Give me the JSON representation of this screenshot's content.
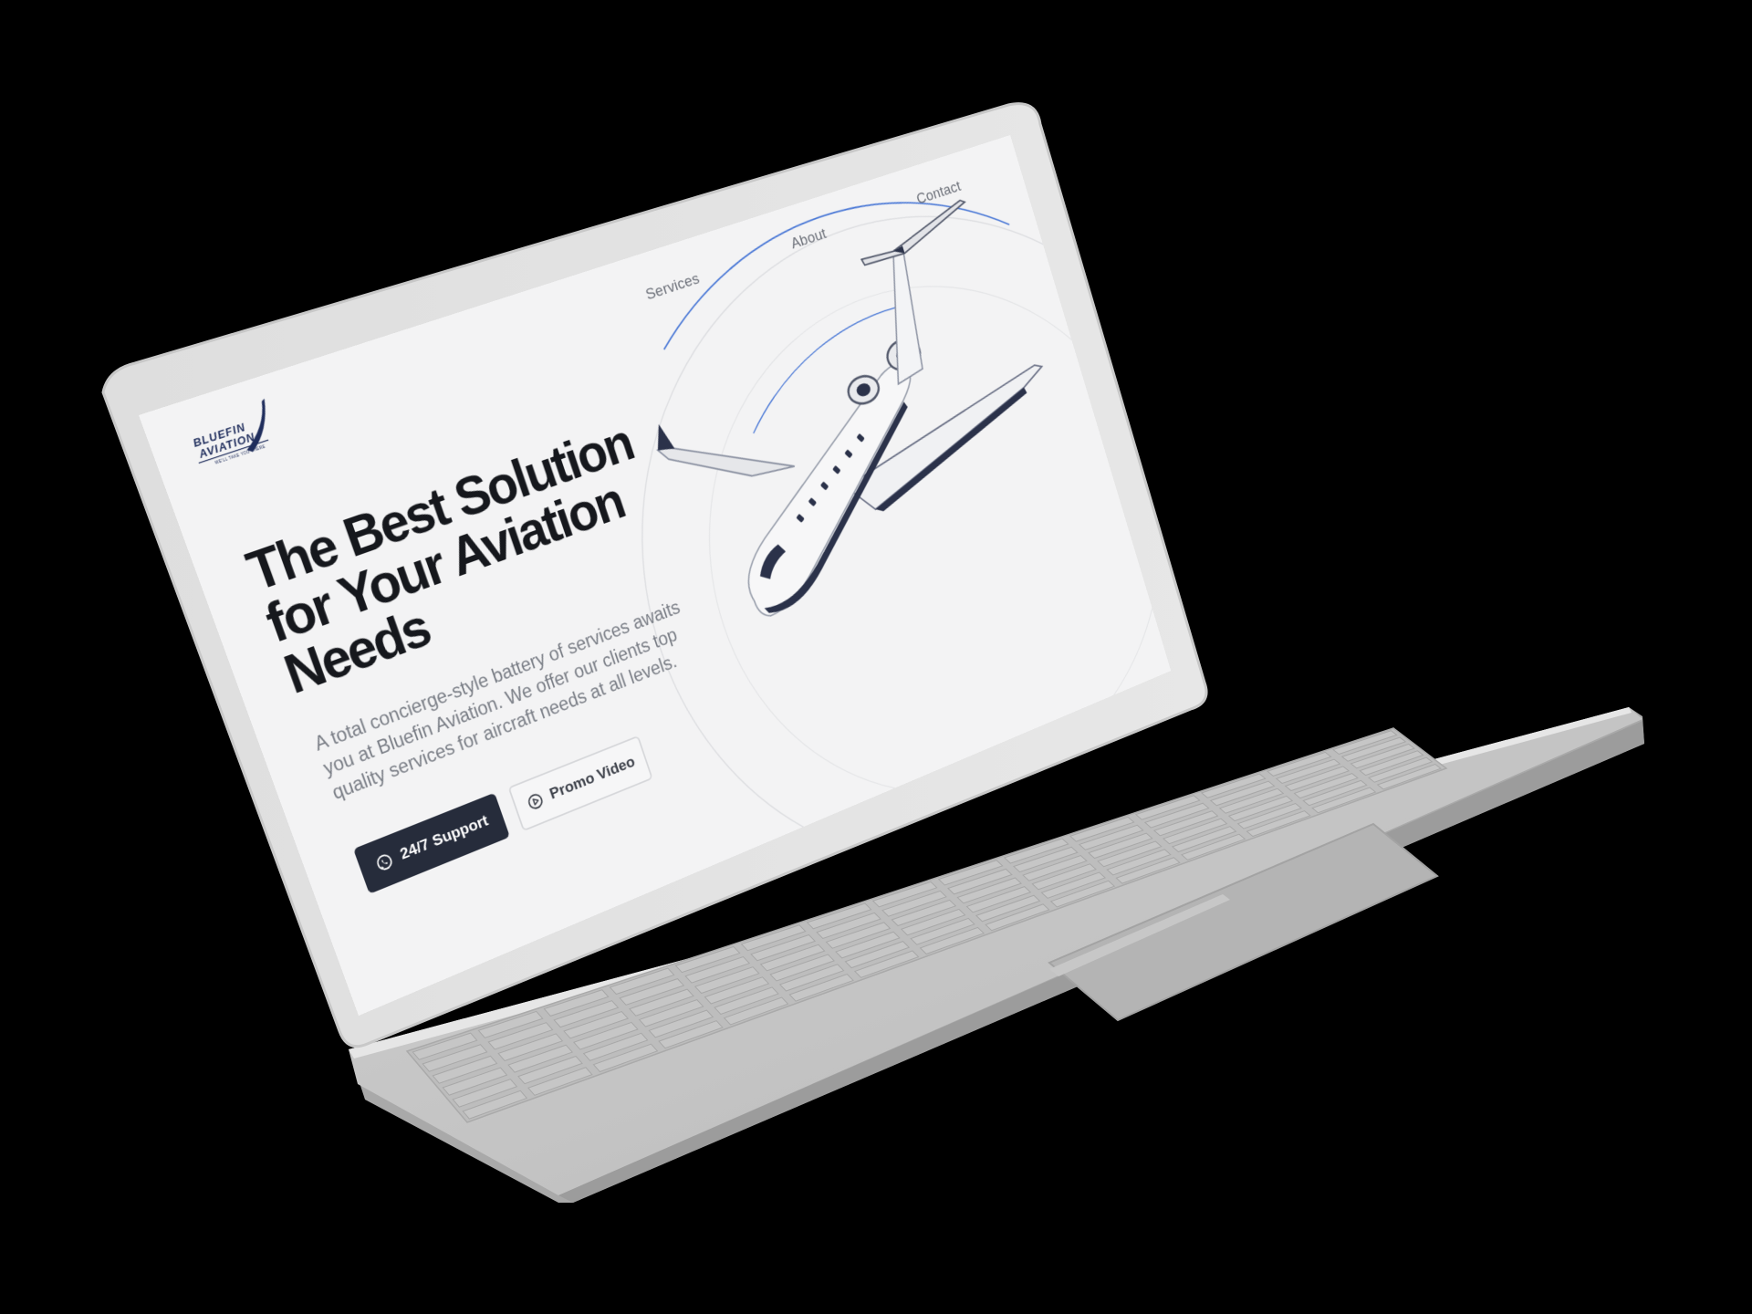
{
  "brand": {
    "name_line1": "BLUEFIN",
    "name_line2": "AVIATION",
    "tagline": "WE'LL TAKE YOU THERE",
    "navy": "#1f2d5c",
    "accent_blue": "#4a78d6"
  },
  "nav": {
    "items": [
      "Services",
      "About",
      "Contact"
    ]
  },
  "hero": {
    "title_lines": [
      "The Best Solution",
      "for Your Aviation",
      "Needs"
    ],
    "subtitle_lines": [
      "A total concierge-style battery of services awaits",
      "you at Bluefin Aviation. We offer our clients top",
      "quality services for aircraft needs at all levels."
    ],
    "primary_button": {
      "label": "24/7 Support",
      "icon": "whatsapp-icon"
    },
    "secondary_button": {
      "label": "Promo Video",
      "icon": "play-circle-icon"
    }
  },
  "visual": {
    "subject": "private-jet-illustration",
    "aircraft_registration": "",
    "screen_background": "#f3f3f4",
    "laptop_body": "#d6d6d6",
    "page_background": "#000000"
  }
}
